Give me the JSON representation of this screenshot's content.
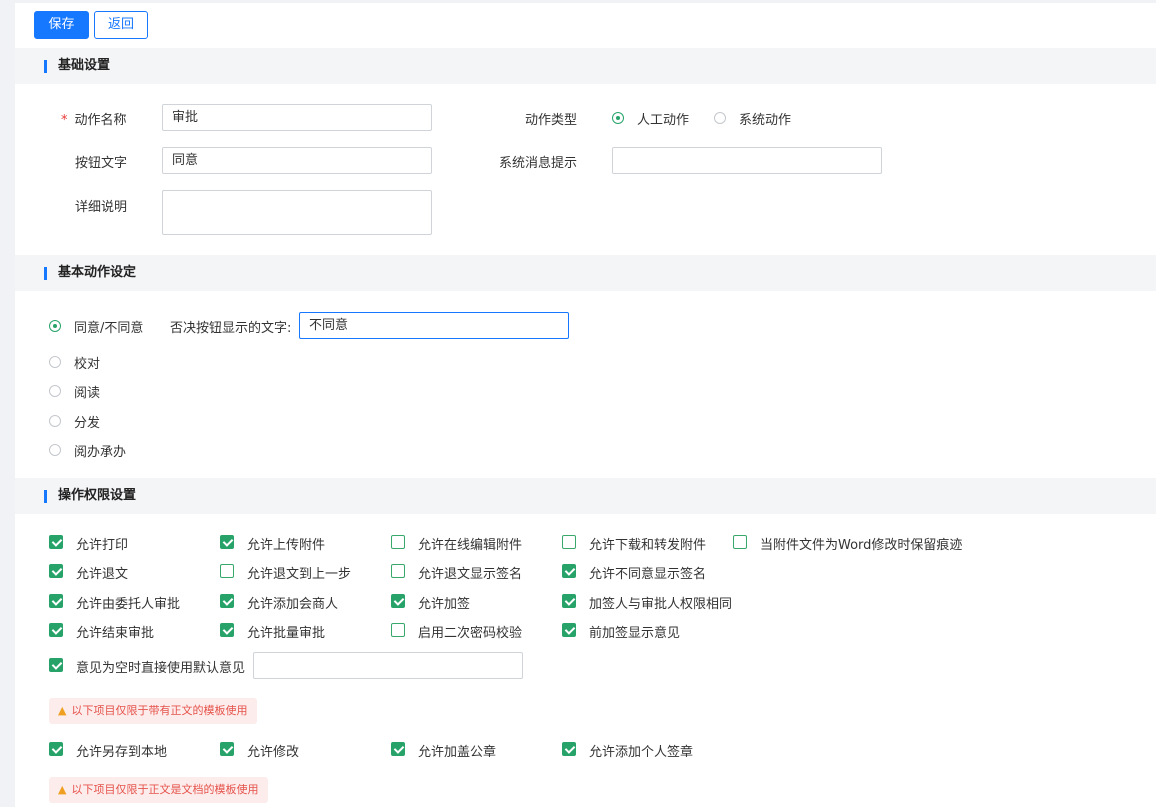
{
  "toolbar": {
    "save_label": "保存",
    "back_label": "返回"
  },
  "sections": {
    "basic": "基础设置",
    "action": "基本动作设定",
    "permissions": "操作权限设置"
  },
  "basic": {
    "required_mark": "*",
    "action_name_label": "动作名称",
    "action_name_value": "审批",
    "button_text_label": "按钮文字",
    "button_text_value": "同意",
    "detail_label": "详细说明",
    "detail_value": "",
    "action_type_label": "动作类型",
    "action_type_options": [
      {
        "label": "人工动作",
        "selected": true
      },
      {
        "label": "系统动作",
        "selected": false
      }
    ],
    "sys_msg_label": "系统消息提示",
    "sys_msg_value": ""
  },
  "action": {
    "options": [
      {
        "label": "同意/不同意",
        "selected": true
      },
      {
        "label": "校对",
        "selected": false
      },
      {
        "label": "阅读",
        "selected": false
      },
      {
        "label": "分发",
        "selected": false
      },
      {
        "label": "阅办承办",
        "selected": false
      }
    ],
    "reject_text_label": "否决按钮显示的文字:",
    "reject_text_value": "不同意"
  },
  "permissions": {
    "row1": [
      {
        "label": "允许打印",
        "checked": true
      },
      {
        "label": "允许上传附件",
        "checked": true
      },
      {
        "label": "允许在线编辑附件",
        "checked": false
      },
      {
        "label": "允许下载和转发附件",
        "checked": false
      },
      {
        "label": "当附件文件为Word修改时保留痕迹",
        "checked": false
      }
    ],
    "row2": [
      {
        "label": "允许退文",
        "checked": true
      },
      {
        "label": "允许退文到上一步",
        "checked": false
      },
      {
        "label": "允许退文显示签名",
        "checked": false
      },
      {
        "label": "允许不同意显示签名",
        "checked": true
      }
    ],
    "row3": [
      {
        "label": "允许由委托人审批",
        "checked": true
      },
      {
        "label": "允许添加会商人",
        "checked": true
      },
      {
        "label": "允许加签",
        "checked": true
      },
      {
        "label": "加签人与审批人权限相同",
        "checked": true
      }
    ],
    "row4": [
      {
        "label": "允许结束审批",
        "checked": true
      },
      {
        "label": "允许批量审批",
        "checked": true
      },
      {
        "label": "启用二次密码校验",
        "checked": false
      },
      {
        "label": "前加签显示意见",
        "checked": true
      }
    ],
    "default_opinion": {
      "label": "意见为空时直接使用默认意见",
      "checked": true,
      "value": ""
    },
    "notice_body": "以下项目仅限于带有正文的模板使用",
    "row_body": [
      {
        "label": "允许另存到本地",
        "checked": true
      },
      {
        "label": "允许修改",
        "checked": true
      },
      {
        "label": "允许加盖公章",
        "checked": true
      },
      {
        "label": "允许添加个人签章",
        "checked": true
      }
    ],
    "notice_doc": "以下项目仅限于正文是文档的模板使用"
  }
}
